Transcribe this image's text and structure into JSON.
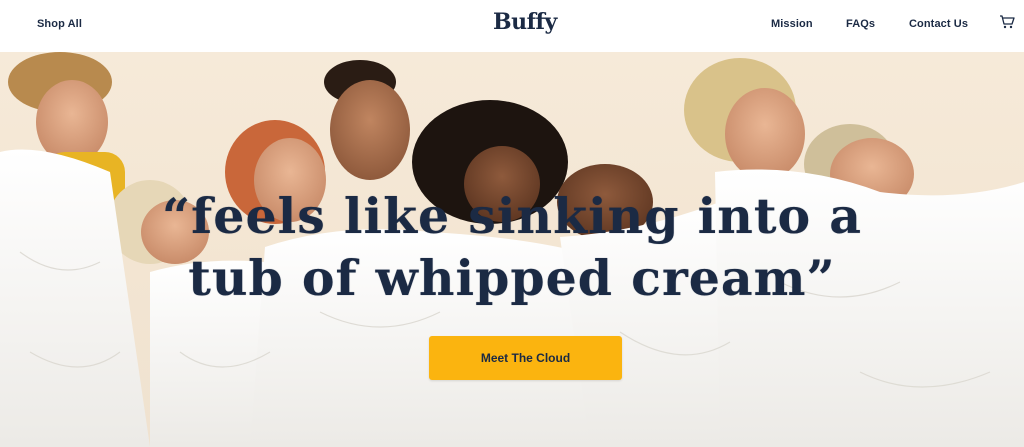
{
  "header": {
    "shop_all": "Shop All",
    "logo": "Buffy",
    "nav": {
      "mission": "Mission",
      "faqs": "FAQs",
      "contact": "Contact Us"
    },
    "cart_icon": "cart-icon"
  },
  "hero": {
    "headline_line1": "“feels like sinking into a",
    "headline_line2": "tub of whipped cream”",
    "cta_label": "Meet The Cloud",
    "colors": {
      "brand_navy": "#1b2a44",
      "cta_yellow": "#fbb40f",
      "background": "#f5e8d6",
      "duvet": "#ffffff"
    }
  }
}
